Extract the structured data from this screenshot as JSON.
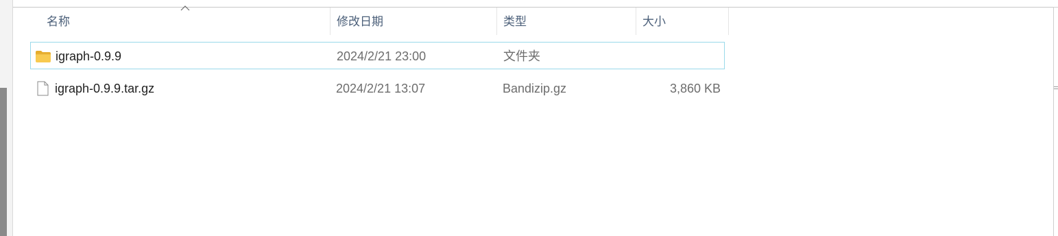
{
  "columns": {
    "name": "名称",
    "date_modified": "修改日期",
    "type": "类型",
    "size": "大小",
    "sort_indicator": "ascending"
  },
  "files": [
    {
      "icon": "folder-icon",
      "name": "igraph-0.9.9",
      "date_modified": "2024/2/21 23:00",
      "type": "文件夹",
      "size": "",
      "selected": true
    },
    {
      "icon": "file-icon",
      "name": "igraph-0.9.9.tar.gz",
      "date_modified": "2024/2/21 13:07",
      "type": "Bandizip.gz",
      "size": "3,860 KB",
      "selected": false
    }
  ],
  "colors": {
    "header_text": "#4c607a",
    "selection_border": "#99d9ea",
    "folder": "#f5c443"
  }
}
